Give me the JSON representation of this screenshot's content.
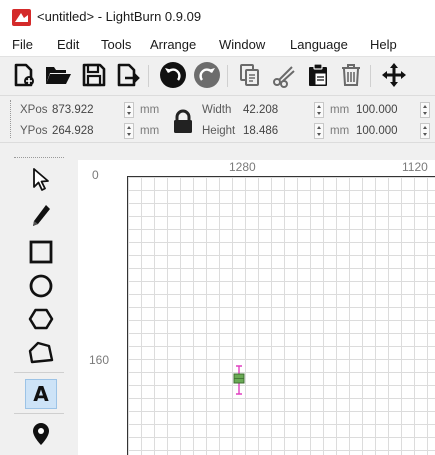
{
  "window": {
    "title": "<untitled> - LightBurn 0.9.09"
  },
  "menu": {
    "items": [
      "File",
      "Edit",
      "Tools",
      "Arrange",
      "Window",
      "Language",
      "Help"
    ]
  },
  "toolbar": {
    "icons": [
      "new-file-icon",
      "open-folder-icon",
      "save-icon",
      "import-icon",
      "undo-icon",
      "redo-icon",
      "copy-icon",
      "cut-icon",
      "paste-icon",
      "delete-icon",
      "move-icon"
    ]
  },
  "numeric": {
    "xpos_label": "XPos",
    "xpos_value": "873.922",
    "xpos_unit": "mm",
    "ypos_label": "YPos",
    "ypos_value": "264.928",
    "ypos_unit": "mm",
    "width_label": "Width",
    "width_value": "42.208",
    "width_unit": "mm",
    "height_label": "Height",
    "height_value": "18.486",
    "height_unit": "mm",
    "scale_w": "100.000",
    "scale_h": "100.000"
  },
  "left_tools": {
    "icons": [
      "select-arrow-icon",
      "pencil-icon",
      "rectangle-icon",
      "ellipse-icon",
      "polygon-icon",
      "edit-nodes-icon",
      "text-icon",
      "position-pin-icon"
    ],
    "text_tool_label": "A"
  },
  "rulers": {
    "top_label": "1280",
    "top_label_right": "1120",
    "left_label_top": "0",
    "left_label_mid": "160"
  },
  "colors": {
    "accent": "#cde3f7",
    "shape_stroke": "#e040c0",
    "shape_fill": "#6aaa55"
  }
}
